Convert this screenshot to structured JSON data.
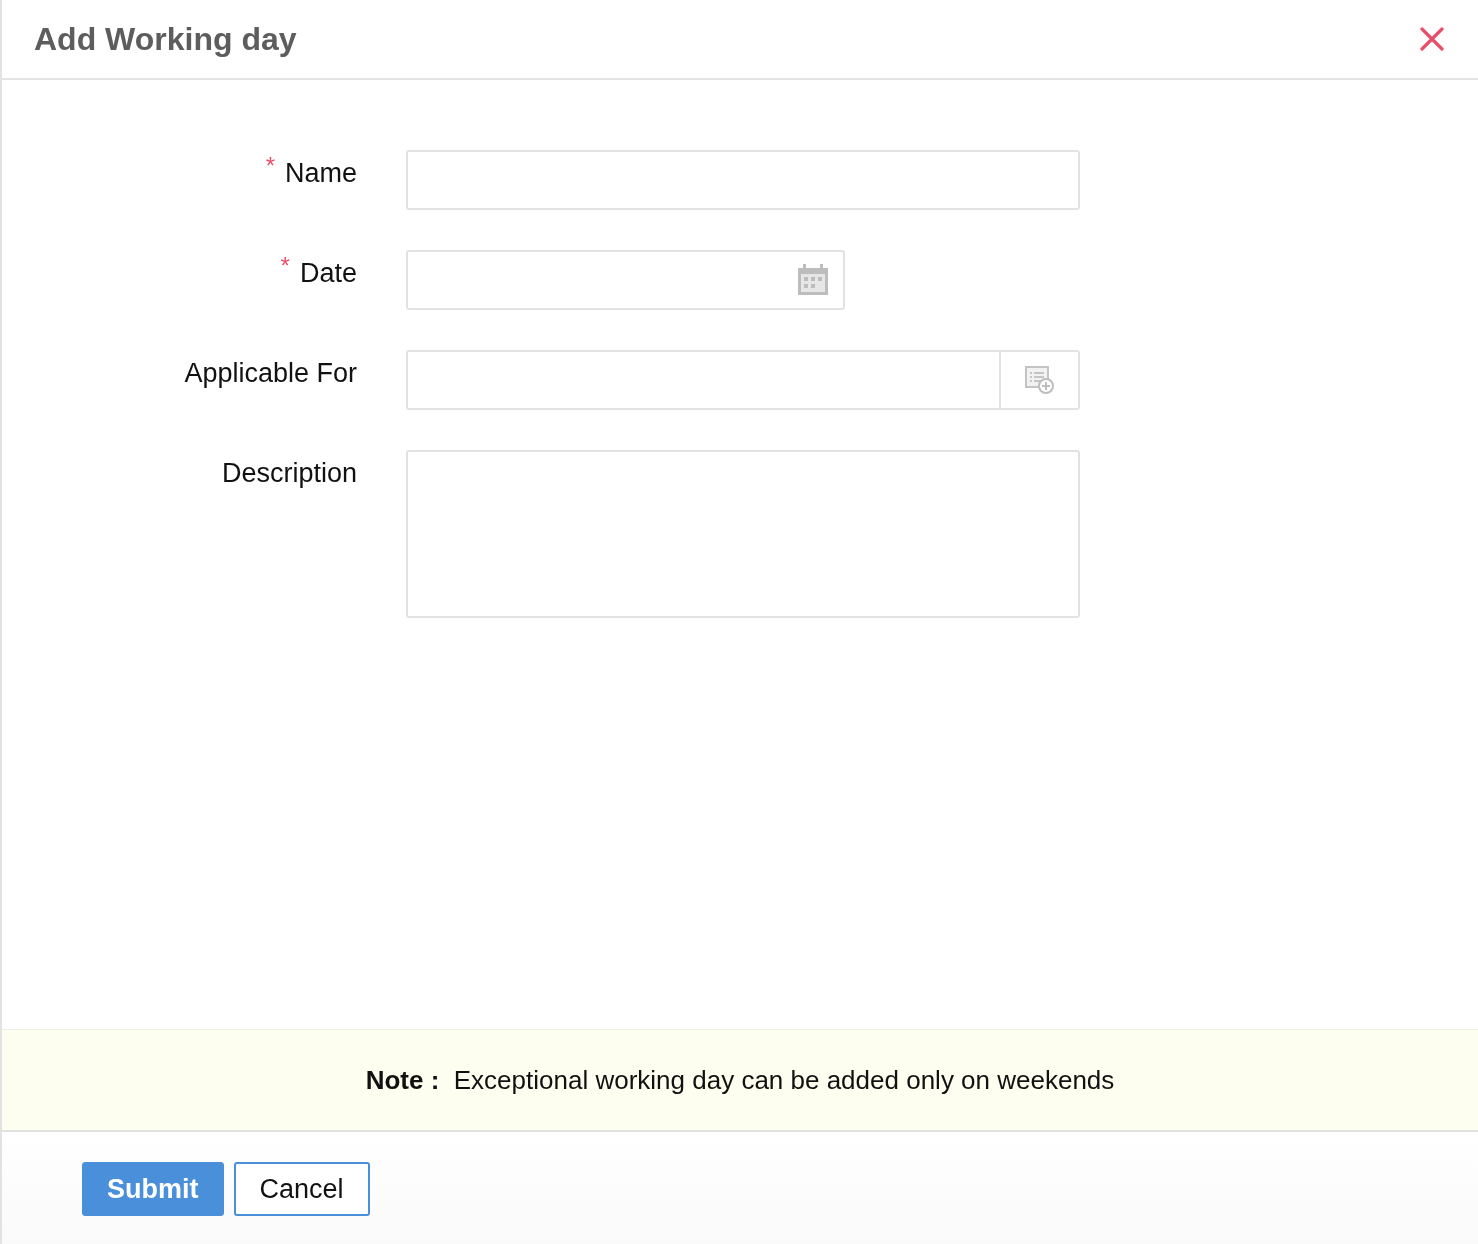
{
  "dialog": {
    "title": "Add Working day"
  },
  "fields": [
    {
      "label": "Name",
      "required_mark": "*",
      "kind": "text"
    },
    {
      "label": "Date",
      "required_mark": "*",
      "kind": "date"
    },
    {
      "label": "Applicable For",
      "kind": "lookup"
    },
    {
      "label": "Description",
      "kind": "textarea"
    }
  ],
  "note": "**Note :**  Exceptional working day can be added only on weekends",
  "buttons": [
    {
      "label": "Submit",
      "kind": "primary"
    },
    {
      "label": "Cancel",
      "kind": "secondary"
    }
  ]
}
